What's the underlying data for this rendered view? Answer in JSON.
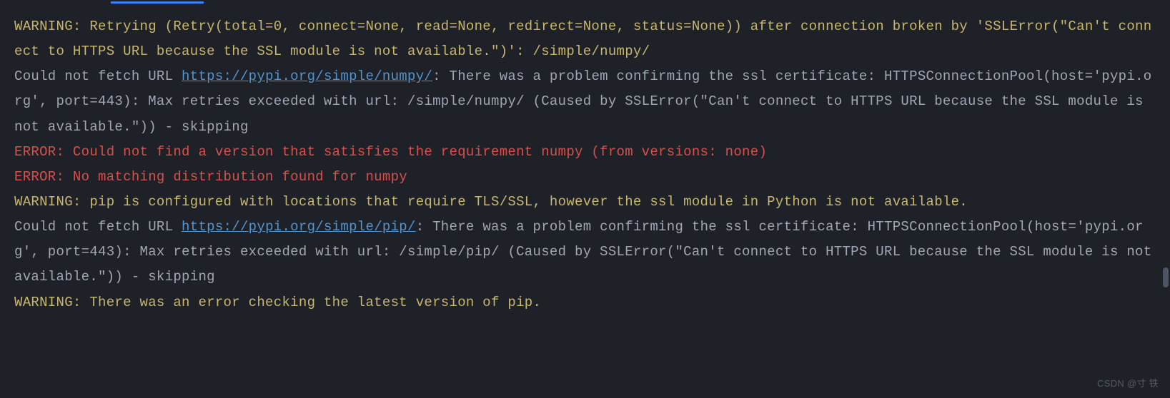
{
  "lines": [
    {
      "segments": [
        {
          "type": "warning",
          "text": "WARNING: Retrying (Retry(total=0, connect=None, read=None, redirect=None, status=None)) after connection broken by 'SSLError(\"Can't connect to HTTPS URL because the SSL module is not available.\")': /simple/numpy/"
        }
      ]
    },
    {
      "segments": [
        {
          "type": "normal",
          "text": "Could not fetch URL "
        },
        {
          "type": "link",
          "text": "https://pypi.org/simple/numpy/"
        },
        {
          "type": "normal",
          "text": ": There was a problem confirming the ssl certificate: HTTPSConnectionPool(host='pypi.org', port=443): Max retries exceeded with url: /simple/numpy/ (Caused by SSLError(\"Can't connect to HTTPS URL because the SSL module is not available.\")) - skipping"
        }
      ]
    },
    {
      "segments": [
        {
          "type": "error",
          "text": "ERROR: Could not find a version that satisfies the requirement numpy (from versions: none)"
        }
      ]
    },
    {
      "segments": [
        {
          "type": "error",
          "text": "ERROR: No matching distribution found for numpy"
        }
      ]
    },
    {
      "segments": [
        {
          "type": "warning",
          "text": "WARNING: pip is configured with locations that require TLS/SSL, however the ssl module in Python is not available."
        }
      ]
    },
    {
      "segments": [
        {
          "type": "normal",
          "text": "Could not fetch URL "
        },
        {
          "type": "link",
          "text": "https://pypi.org/simple/pip/"
        },
        {
          "type": "normal",
          "text": ": There was a problem confirming the ssl certificate: HTTPSConnectionPool(host='pypi.org', port=443): Max retries exceeded with url: /simple/pip/ (Caused by SSLError(\"Can't connect to HTTPS URL because the SSL module is not available.\")) - skipping"
        }
      ]
    },
    {
      "segments": [
        {
          "type": "warning",
          "text": "WARNING: There was an error checking the latest version of pip."
        }
      ]
    }
  ],
  "watermark": "CSDN @寸 铁"
}
